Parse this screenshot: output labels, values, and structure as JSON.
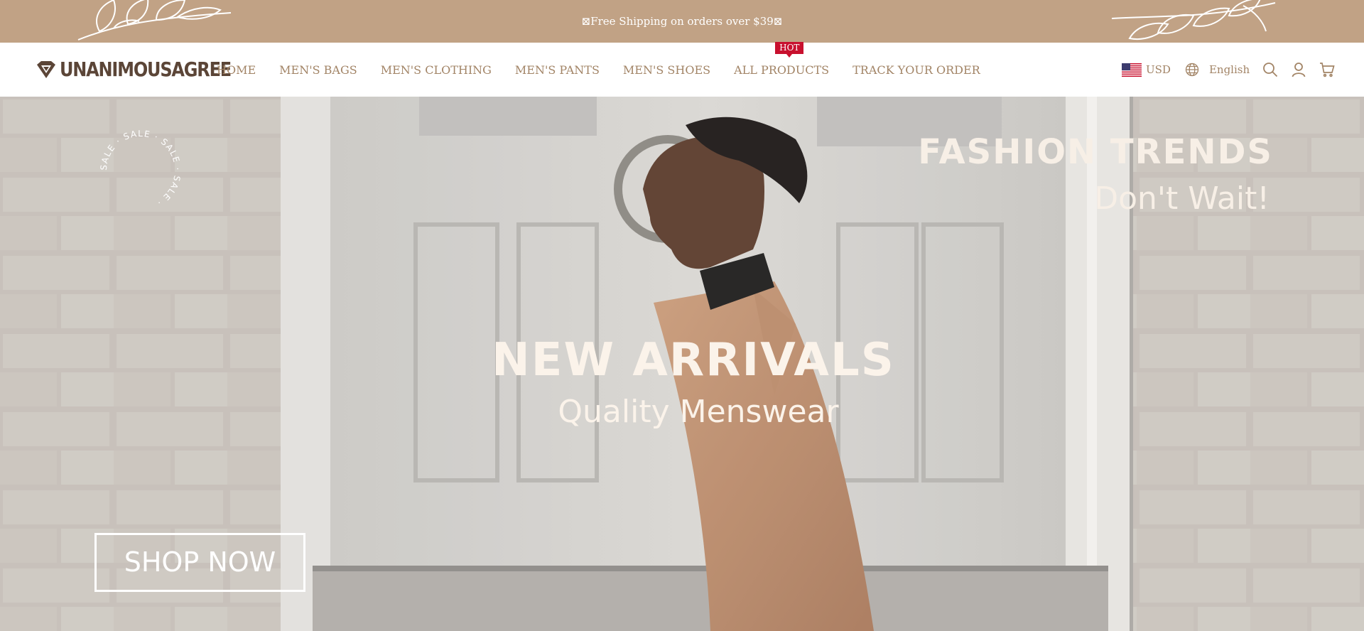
{
  "announcement": {
    "text": "⊠Free Shipping on orders over $39⊠"
  },
  "brand": {
    "name": "UNANIMOUSAGREE"
  },
  "nav": {
    "items": [
      {
        "label": "HOME"
      },
      {
        "label": "MEN'S BAGS"
      },
      {
        "label": "MEN'S CLOTHING"
      },
      {
        "label": "MEN'S PANTS"
      },
      {
        "label": "MEN'S SHOES"
      },
      {
        "label": "ALL PRODUCTS",
        "badge": "HOT"
      },
      {
        "label": "TRACK YOUR ORDER"
      }
    ]
  },
  "header": {
    "currency": "USD",
    "language": "English",
    "icons": [
      "us-flag-icon",
      "globe-icon",
      "search-icon",
      "account-icon",
      "cart-icon"
    ]
  },
  "hero": {
    "sale_badge_text": "SALE · SALE · SALE · SALE ·",
    "headline_right": "FASHION TRENDS",
    "subline_right": "Don't Wait!",
    "headline_center": "NEW ARRIVALS",
    "subline_center": "Quality Menswear",
    "cta": "SHOP NOW"
  },
  "colors": {
    "announcement_bg": "#c1a285",
    "nav_text": "#a28466",
    "logo_text": "#5b4537",
    "hot_badge": "#c8102e",
    "hero_text": "#fbf3ea"
  }
}
